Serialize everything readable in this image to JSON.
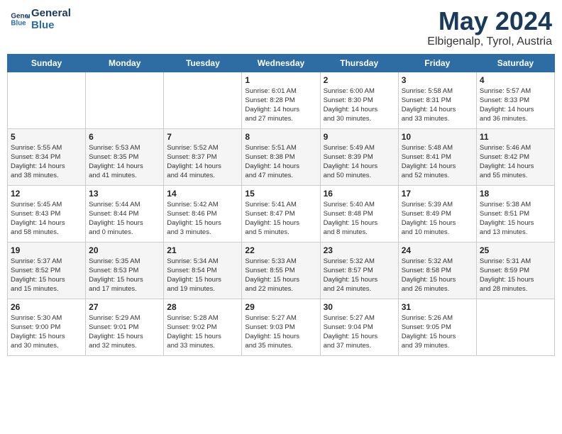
{
  "logo": {
    "line1": "General",
    "line2": "Blue"
  },
  "title": "May 2024",
  "location": "Elbigenalp, Tyrol, Austria",
  "headers": [
    "Sunday",
    "Monday",
    "Tuesday",
    "Wednesday",
    "Thursday",
    "Friday",
    "Saturday"
  ],
  "weeks": [
    [
      {
        "day": "",
        "info": ""
      },
      {
        "day": "",
        "info": ""
      },
      {
        "day": "",
        "info": ""
      },
      {
        "day": "1",
        "info": "Sunrise: 6:01 AM\nSunset: 8:28 PM\nDaylight: 14 hours\nand 27 minutes."
      },
      {
        "day": "2",
        "info": "Sunrise: 6:00 AM\nSunset: 8:30 PM\nDaylight: 14 hours\nand 30 minutes."
      },
      {
        "day": "3",
        "info": "Sunrise: 5:58 AM\nSunset: 8:31 PM\nDaylight: 14 hours\nand 33 minutes."
      },
      {
        "day": "4",
        "info": "Sunrise: 5:57 AM\nSunset: 8:33 PM\nDaylight: 14 hours\nand 36 minutes."
      }
    ],
    [
      {
        "day": "5",
        "info": "Sunrise: 5:55 AM\nSunset: 8:34 PM\nDaylight: 14 hours\nand 38 minutes."
      },
      {
        "day": "6",
        "info": "Sunrise: 5:53 AM\nSunset: 8:35 PM\nDaylight: 14 hours\nand 41 minutes."
      },
      {
        "day": "7",
        "info": "Sunrise: 5:52 AM\nSunset: 8:37 PM\nDaylight: 14 hours\nand 44 minutes."
      },
      {
        "day": "8",
        "info": "Sunrise: 5:51 AM\nSunset: 8:38 PM\nDaylight: 14 hours\nand 47 minutes."
      },
      {
        "day": "9",
        "info": "Sunrise: 5:49 AM\nSunset: 8:39 PM\nDaylight: 14 hours\nand 50 minutes."
      },
      {
        "day": "10",
        "info": "Sunrise: 5:48 AM\nSunset: 8:41 PM\nDaylight: 14 hours\nand 52 minutes."
      },
      {
        "day": "11",
        "info": "Sunrise: 5:46 AM\nSunset: 8:42 PM\nDaylight: 14 hours\nand 55 minutes."
      }
    ],
    [
      {
        "day": "12",
        "info": "Sunrise: 5:45 AM\nSunset: 8:43 PM\nDaylight: 14 hours\nand 58 minutes."
      },
      {
        "day": "13",
        "info": "Sunrise: 5:44 AM\nSunset: 8:44 PM\nDaylight: 15 hours\nand 0 minutes."
      },
      {
        "day": "14",
        "info": "Sunrise: 5:42 AM\nSunset: 8:46 PM\nDaylight: 15 hours\nand 3 minutes."
      },
      {
        "day": "15",
        "info": "Sunrise: 5:41 AM\nSunset: 8:47 PM\nDaylight: 15 hours\nand 5 minutes."
      },
      {
        "day": "16",
        "info": "Sunrise: 5:40 AM\nSunset: 8:48 PM\nDaylight: 15 hours\nand 8 minutes."
      },
      {
        "day": "17",
        "info": "Sunrise: 5:39 AM\nSunset: 8:49 PM\nDaylight: 15 hours\nand 10 minutes."
      },
      {
        "day": "18",
        "info": "Sunrise: 5:38 AM\nSunset: 8:51 PM\nDaylight: 15 hours\nand 13 minutes."
      }
    ],
    [
      {
        "day": "19",
        "info": "Sunrise: 5:37 AM\nSunset: 8:52 PM\nDaylight: 15 hours\nand 15 minutes."
      },
      {
        "day": "20",
        "info": "Sunrise: 5:35 AM\nSunset: 8:53 PM\nDaylight: 15 hours\nand 17 minutes."
      },
      {
        "day": "21",
        "info": "Sunrise: 5:34 AM\nSunset: 8:54 PM\nDaylight: 15 hours\nand 19 minutes."
      },
      {
        "day": "22",
        "info": "Sunrise: 5:33 AM\nSunset: 8:55 PM\nDaylight: 15 hours\nand 22 minutes."
      },
      {
        "day": "23",
        "info": "Sunrise: 5:32 AM\nSunset: 8:57 PM\nDaylight: 15 hours\nand 24 minutes."
      },
      {
        "day": "24",
        "info": "Sunrise: 5:32 AM\nSunset: 8:58 PM\nDaylight: 15 hours\nand 26 minutes."
      },
      {
        "day": "25",
        "info": "Sunrise: 5:31 AM\nSunset: 8:59 PM\nDaylight: 15 hours\nand 28 minutes."
      }
    ],
    [
      {
        "day": "26",
        "info": "Sunrise: 5:30 AM\nSunset: 9:00 PM\nDaylight: 15 hours\nand 30 minutes."
      },
      {
        "day": "27",
        "info": "Sunrise: 5:29 AM\nSunset: 9:01 PM\nDaylight: 15 hours\nand 32 minutes."
      },
      {
        "day": "28",
        "info": "Sunrise: 5:28 AM\nSunset: 9:02 PM\nDaylight: 15 hours\nand 33 minutes."
      },
      {
        "day": "29",
        "info": "Sunrise: 5:27 AM\nSunset: 9:03 PM\nDaylight: 15 hours\nand 35 minutes."
      },
      {
        "day": "30",
        "info": "Sunrise: 5:27 AM\nSunset: 9:04 PM\nDaylight: 15 hours\nand 37 minutes."
      },
      {
        "day": "31",
        "info": "Sunrise: 5:26 AM\nSunset: 9:05 PM\nDaylight: 15 hours\nand 39 minutes."
      },
      {
        "day": "",
        "info": ""
      }
    ]
  ]
}
